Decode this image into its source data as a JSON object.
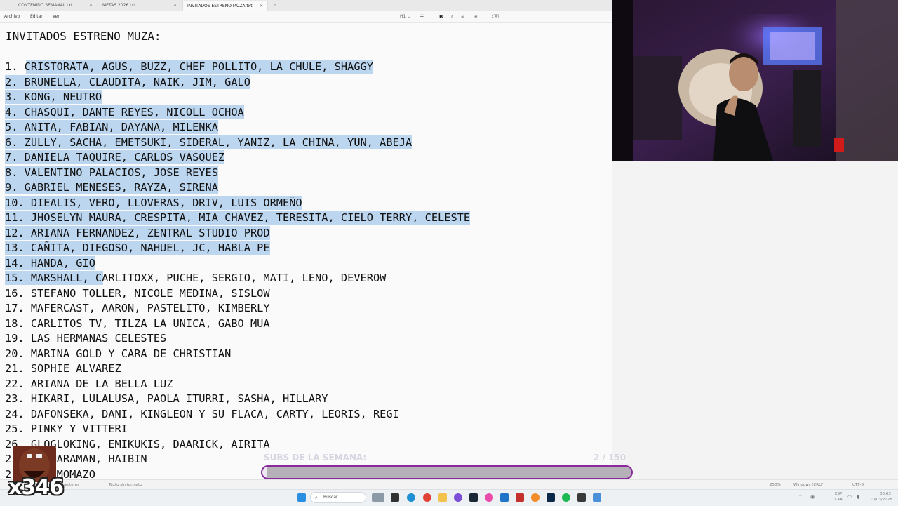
{
  "tabs": [
    {
      "label": "CONTENIDO SEMANAL.txt",
      "active": false
    },
    {
      "label": "METAS 2026.txt",
      "active": false
    },
    {
      "label": "INVITADOS ESTRENO MUZA.txt",
      "active": true
    }
  ],
  "menu": {
    "file": "Archivo",
    "edit": "Editar",
    "view": "Ver"
  },
  "toolbar": {
    "heading": "H1",
    "bold": "B",
    "italic": "I"
  },
  "document": {
    "title": "INVITADOS ESTRENO MUZA:",
    "lines": [
      "1. CRISTORATA, AGUS, BUZZ, CHEF POLLITO, LA CHULE, SHAGGY",
      "2. BRUNELLA, CLAUDITA, NAIK, JIM, GALO",
      "3. KONG, NEUTRO",
      "4. CHASQUI, DANTE REYES, NICOLL OCHOA",
      "5. ANITA, FABIAN, DAYANA, MILENKA",
      "6. ZULLY, SACHA, EMETSUKI, SIDERAL, YANIZ, LA CHINA, YUN, ABEJA",
      "7. DANIELA TAQUIRE, CARLOS VASQUEZ",
      "8. VALENTINO PALACIOS, JOSE REYES",
      "9. GABRIEL MENESES, RAYZA, SIRENA",
      "10. DIEALIS, VERO, LLOVERAS, DRIV, LUIS ORMEÑO",
      "11. JHOSELYN MAURA, CRESPITA, MIA CHAVEZ, TERESITA, CIELO TERRY, CELESTE",
      "12. ARIANA FERNANDEZ, ZENTRAL STUDIO PROD",
      "13. CAÑITA, DIEGOSO, NAHUEL, JC, HABLA PE",
      "14. HANDA, GIO",
      "15. MARSHALL, CARLITOXX, PUCHE, SERGIO, MATI, LENO, DEVEROW",
      "16. STEFANO TOLLER, NICOLE MEDINA, SISLOW",
      "17. MAFERCAST, AARON, PASTELITO, KIMBERLY",
      "18. CARLITOS TV, TILZA LA UNICA, GABO MUA",
      "19. LAS HERMANAS CELESTES",
      "20. MARINA GOLD Y CARA DE CHRISTIAN",
      "21. SOPHIE ALVAREZ",
      "22. ARIANA DE LA BELLA LUZ",
      "23. HIKARI, LULALUSA, PAOLA ITURRI, SASHA, HILLARY",
      "24. DAFONSEKA, DANI, KINGLEON Y SU FLACA, CARTY, LEORIS, REGI",
      "25. PINKY Y VITTERI",
      "26. GLOGLOKING, EMIKUKIS, DAARICK, AIRITA",
      "2 A, CAMARAMAN, HAIBIN",
      "2 RAIN. MOMAZO"
    ]
  },
  "overlay": {
    "subs_label": "SUBS DE LA SEMANA:",
    "subs_count": "2 / 150",
    "subs_progress": 0.013,
    "emote_count": "x346"
  },
  "statusbar": {
    "chars": "caracteres",
    "format": "Texto sin formato",
    "zoom": "250%",
    "line_ending": "Windows (CRLF)",
    "encoding": "UTF-8"
  },
  "taskbar": {
    "search_placeholder": "Buscar",
    "lang": "ESP",
    "region": "LAA",
    "time": "00:03",
    "date": "10/03/2026"
  },
  "colors": {
    "selection": "#bcd6f0",
    "progress_border": "#8a2a9e"
  }
}
